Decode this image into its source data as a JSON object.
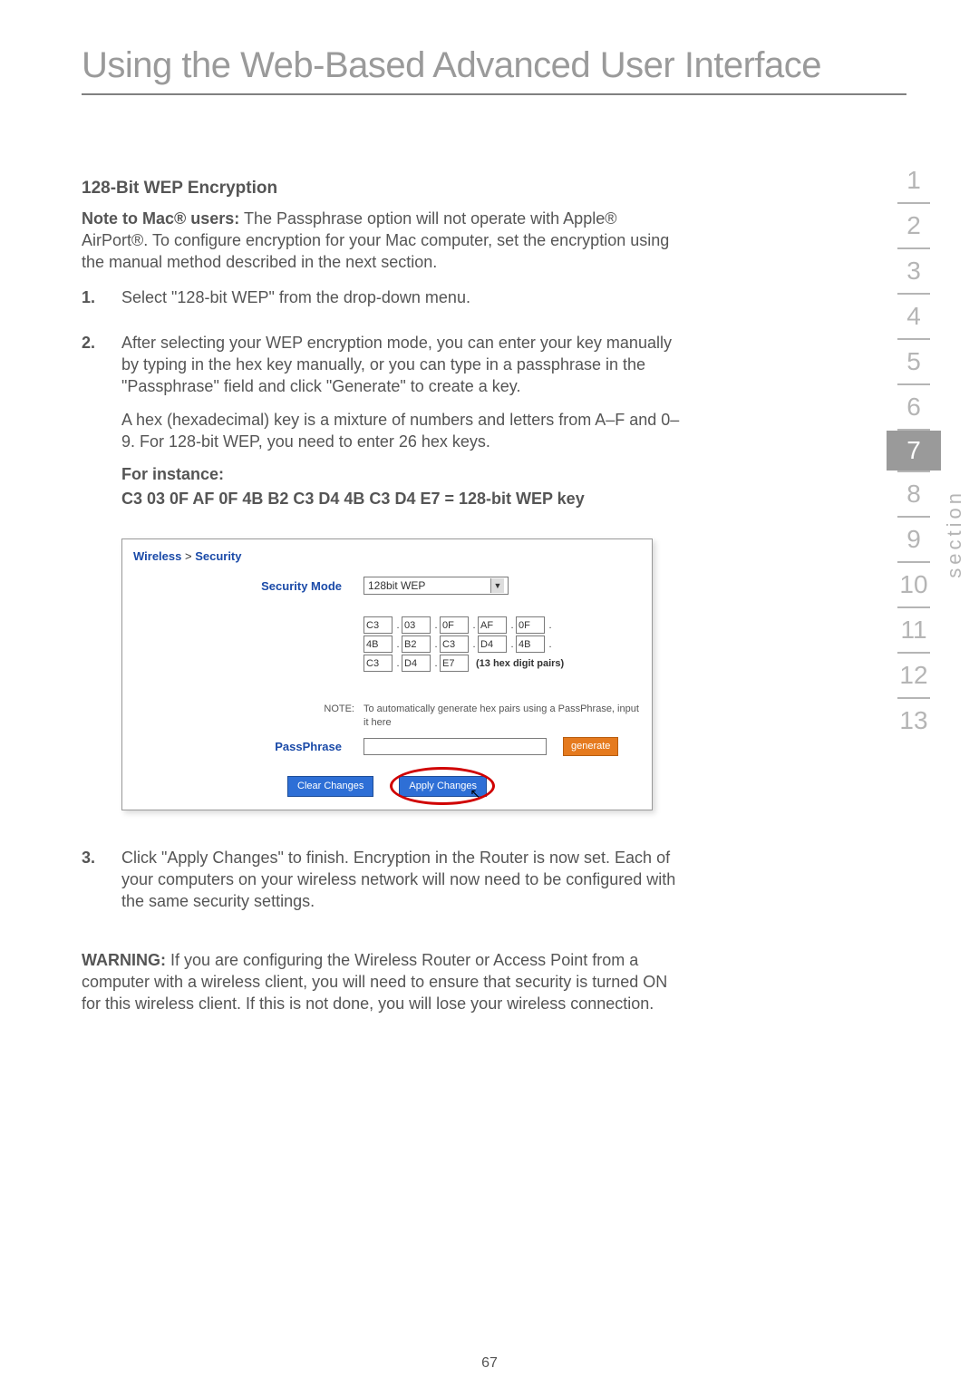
{
  "page_title": "Using the Web-Based Advanced User Interface",
  "h2": "128-Bit WEP Encryption",
  "note_mac_label": "Note to Mac® users:",
  "note_mac_body": " The Passphrase option will not operate with Apple® AirPort®. To configure encryption for your Mac computer, set the encryption using the manual method described in the next section.",
  "step1_num": "1.",
  "step1": "Select \"128-bit WEP\" from the drop-down menu.",
  "step2_num": "2.",
  "step2_p1": "After selecting your WEP encryption mode, you can enter your key manually by typing in the hex key manually, or you can type in a passphrase in the \"Passphrase\" field and click \"Generate\" to create a key.",
  "step2_p2": "A hex (hexadecimal) key is a mixture of numbers and letters from A–F and 0–9. For 128-bit WEP, you need to enter 26 hex keys.",
  "for_instance": "For instance:",
  "hex_example": "C3 03 0F AF 0F 4B B2 C3 D4 4B C3 D4 E7 = 128-bit WEP key",
  "router": {
    "breadcrumb1": "Wireless",
    "breadcrumb_sep": " > ",
    "breadcrumb2": "Security",
    "label_security_mode": "Security Mode",
    "security_mode_value": "128bit WEP",
    "hex_rows": [
      [
        "C3",
        "03",
        "0F",
        "AF",
        "0F"
      ],
      [
        "4B",
        "B2",
        "C3",
        "D4",
        "4B"
      ],
      [
        "C3",
        "D4",
        "E7"
      ]
    ],
    "hex_pairs_note": "(13 hex digit pairs)",
    "note_label": "NOTE:",
    "note_text": "To automatically generate hex pairs using a PassPhrase, input it here",
    "passphrase_label": "PassPhrase",
    "generate_btn": "generate",
    "clear_btn": "Clear Changes",
    "apply_btn": "Apply Changes"
  },
  "step3_num": "3.",
  "step3": "Click \"Apply Changes\" to finish. Encryption in the Router is now set. Each of your computers on your wireless network will now need to be configured with the same security settings.",
  "warning_label": "WARNING:",
  "warning_body": " If you are configuring the Wireless Router or Access Point from a computer with a wireless client, you will need to ensure that security is turned ON for this wireless client. If this is not done, you will lose your wireless connection.",
  "sidenav": [
    "1",
    "2",
    "3",
    "4",
    "5",
    "6",
    "7",
    "8",
    "9",
    "10",
    "11",
    "12",
    "13"
  ],
  "active_section": "7",
  "section_label": "section",
  "page_number": "67"
}
